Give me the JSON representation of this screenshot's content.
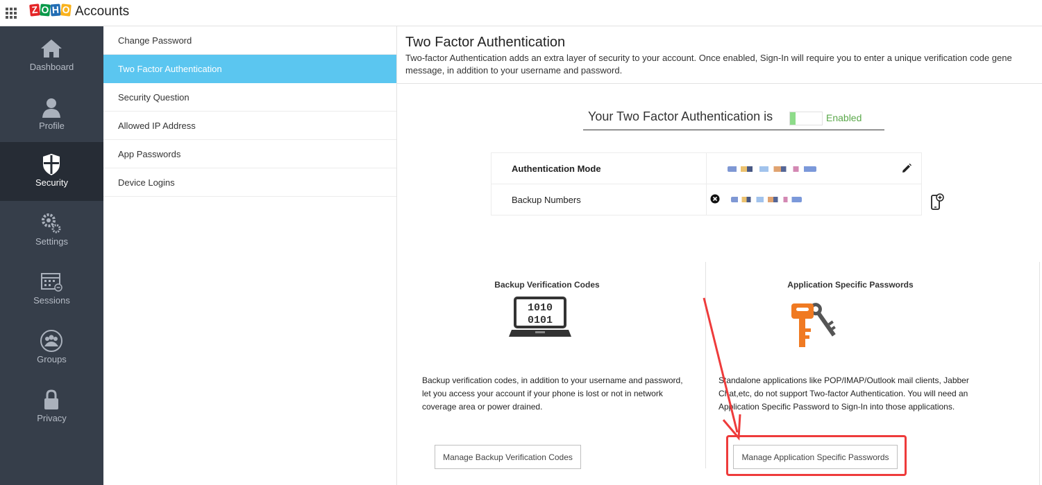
{
  "app": {
    "title": "Accounts",
    "logo_letters": [
      "Z",
      "O",
      "H",
      "O"
    ]
  },
  "sidebar": {
    "items": [
      {
        "label": "Dashboard",
        "icon": "home-icon"
      },
      {
        "label": "Profile",
        "icon": "user-icon"
      },
      {
        "label": "Security",
        "icon": "shield-icon",
        "active": true
      },
      {
        "label": "Settings",
        "icon": "gear-icon"
      },
      {
        "label": "Sessions",
        "icon": "calendar-icon"
      },
      {
        "label": "Groups",
        "icon": "group-icon"
      },
      {
        "label": "Privacy",
        "icon": "lock-icon"
      }
    ]
  },
  "subnav": {
    "items": [
      {
        "label": "Change Password"
      },
      {
        "label": "Two Factor Authentication",
        "active": true
      },
      {
        "label": "Security Question"
      },
      {
        "label": "Allowed IP Address"
      },
      {
        "label": "App Passwords"
      },
      {
        "label": "Device Logins"
      }
    ]
  },
  "main": {
    "title": "Two Factor Authentication",
    "description": "Two-factor Authentication adds an extra layer of security to your account. Once enabled, Sign-In will require you to enter a unique verification code gene",
    "description_line2": "message, in addition to your username and password.",
    "status_label": "Your Two Factor Authentication is",
    "status_value": "Enabled",
    "auth_mode_label": "Authentication Mode",
    "backup_numbers_label": "Backup Numbers",
    "backup_codes": {
      "title": "Backup Verification Codes",
      "icon_text_line1": "1010",
      "icon_text_line2": "0101",
      "description_lines": [
        "Backup verification codes, in addition to your username and password,",
        "let you access your account if your phone is lost or not in network",
        "coverage area or power drained."
      ],
      "button_label": "Manage Backup Verification Codes"
    },
    "app_passwords": {
      "title": "Application Specific Passwords",
      "description_lines": [
        "Standalone applications like POP/IMAP/Outlook mail clients, Jabber",
        "Chat,etc, do not support Two-factor Authentication. You will need an",
        "Application Specific Password to Sign-In into those applications."
      ],
      "button_label": "Manage Application Specific Passwords"
    }
  },
  "colors": {
    "sidebar_bg": "#363e4a",
    "sidebar_active_bg": "#262c35",
    "subnav_active_bg": "#5bc6f0",
    "enabled_green": "#5aa84a",
    "key_orange": "#f07a22",
    "highlight_red": "#ee3b3b"
  }
}
